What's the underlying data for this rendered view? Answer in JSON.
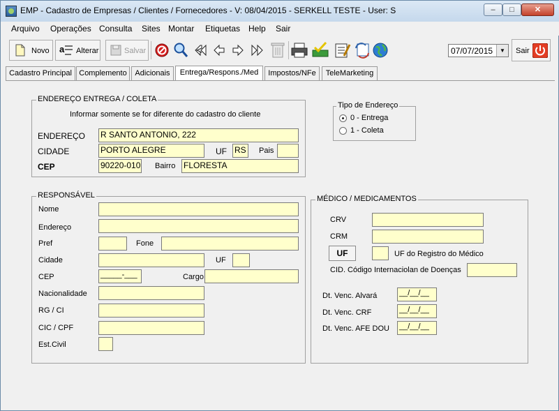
{
  "window": {
    "title": "EMP - Cadastro de Empresas / Clientes / Fornecedores - V: 08/04/2015 - SERKELL TESTE - User: S",
    "minimize": "–",
    "maximize": "□",
    "close": "✕"
  },
  "menu": [
    "Arquivo",
    "Operações",
    "Consulta",
    "Sites",
    "Montar",
    "Etiquetas",
    "Help",
    "Sair"
  ],
  "toolbar": {
    "novo": "Novo",
    "alterar": "Alterar",
    "salvar": "Salvar",
    "date": "07/07/2015",
    "sair": "Sair"
  },
  "tabs": [
    "Cadastro Principal",
    "Complemento",
    "Adicionais",
    "Entrega/Respons./Med",
    "Impostos/NFe",
    "TeleMarketing"
  ],
  "entrega": {
    "legend": "ENDEREÇO ENTREGA / COLETA",
    "note": "Informar somente se for diferente do cadastro do cliente",
    "endereco_label": "ENDEREÇO",
    "endereco": "R SANTO ANTONIO, 222",
    "cidade_label": "CIDADE",
    "cidade": "PORTO ALEGRE",
    "uf_label": "UF",
    "uf": "RS",
    "pais_label": "Pais",
    "pais": "",
    "cep_label": "CEP",
    "cep": "90220-010",
    "bairro_label": "Bairro",
    "bairro": "FLORESTA"
  },
  "tipo_endereco": {
    "legend": "Tipo de Endereço",
    "options": [
      "0 - Entrega",
      "1 - Coleta"
    ],
    "selected": "0 - Entrega"
  },
  "responsavel": {
    "legend": "RESPONSÁVEL",
    "nome": "Nome",
    "endereco": "Endereço",
    "pref": "Pref",
    "fone": "Fone",
    "cidade": "Cidade",
    "uf": "UF",
    "cep": "CEP",
    "cep_mask": "_____-___",
    "cargo": "Cargo",
    "nacionalidade": "Nacionalidade",
    "rg": "RG / CI",
    "cic": "CIC / CPF",
    "estcivil": "Est.Civil"
  },
  "medico": {
    "legend": "MÉDICO / MEDICAMENTOS",
    "crv": "CRV",
    "crm": "CRM",
    "uf_button": "UF",
    "uf_registro": "UF do Registro do Médico",
    "cid": "CID. Código Internaciolan de Doenças",
    "alvara": "Dt. Venc. Alvará",
    "crf": "Dt. Venc. CRF",
    "afe": "Dt. Venc. AFE DOU",
    "date_mask": "__/__/__"
  }
}
